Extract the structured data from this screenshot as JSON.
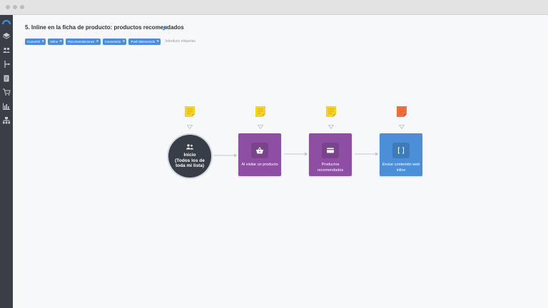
{
  "colors": {
    "sidebar": "#3a3f47",
    "tag": "#4a8ddb",
    "action_purple": "#8e4ea4",
    "send_blue": "#4a8fd8",
    "start_node": "#373e47",
    "note_yellow": "#f5d320",
    "note_orange": "#f0703c"
  },
  "sidebar": {
    "items": [
      {
        "icon": "logo-icon"
      },
      {
        "icon": "layers-icon"
      },
      {
        "icon": "contacts-icon"
      },
      {
        "icon": "automation-icon"
      },
      {
        "icon": "document-icon"
      },
      {
        "icon": "cart-icon"
      },
      {
        "icon": "chart-icon"
      },
      {
        "icon": "organization-icon"
      }
    ]
  },
  "page": {
    "title": "5. Inline en la ficha de producto: productos recomendados"
  },
  "tags": {
    "items": [
      "Convertir",
      "Inline",
      "Recomendaciones",
      "Conversión",
      "Push Bienvenida"
    ],
    "placeholder": "Introduce etiquetas"
  },
  "flow": {
    "start": {
      "label": "Inicio\n(Todos los de\ntoda mi lista)",
      "icon": "people-icon"
    },
    "steps": [
      {
        "label": "Al visitar un producto",
        "icon": "basket-icon",
        "color": "#8e4ea4"
      },
      {
        "label": "Productos recomendados",
        "icon": "card-icon",
        "color": "#8e4ea4"
      },
      {
        "label": "Enviar contenido web inline",
        "icon": "brackets-icon",
        "color": "#4a8fd8"
      }
    ],
    "notes": [
      {
        "color": "#f5d320"
      },
      {
        "color": "#f5d320"
      },
      {
        "color": "#f5d320"
      },
      {
        "color": "#f0703c"
      }
    ]
  }
}
